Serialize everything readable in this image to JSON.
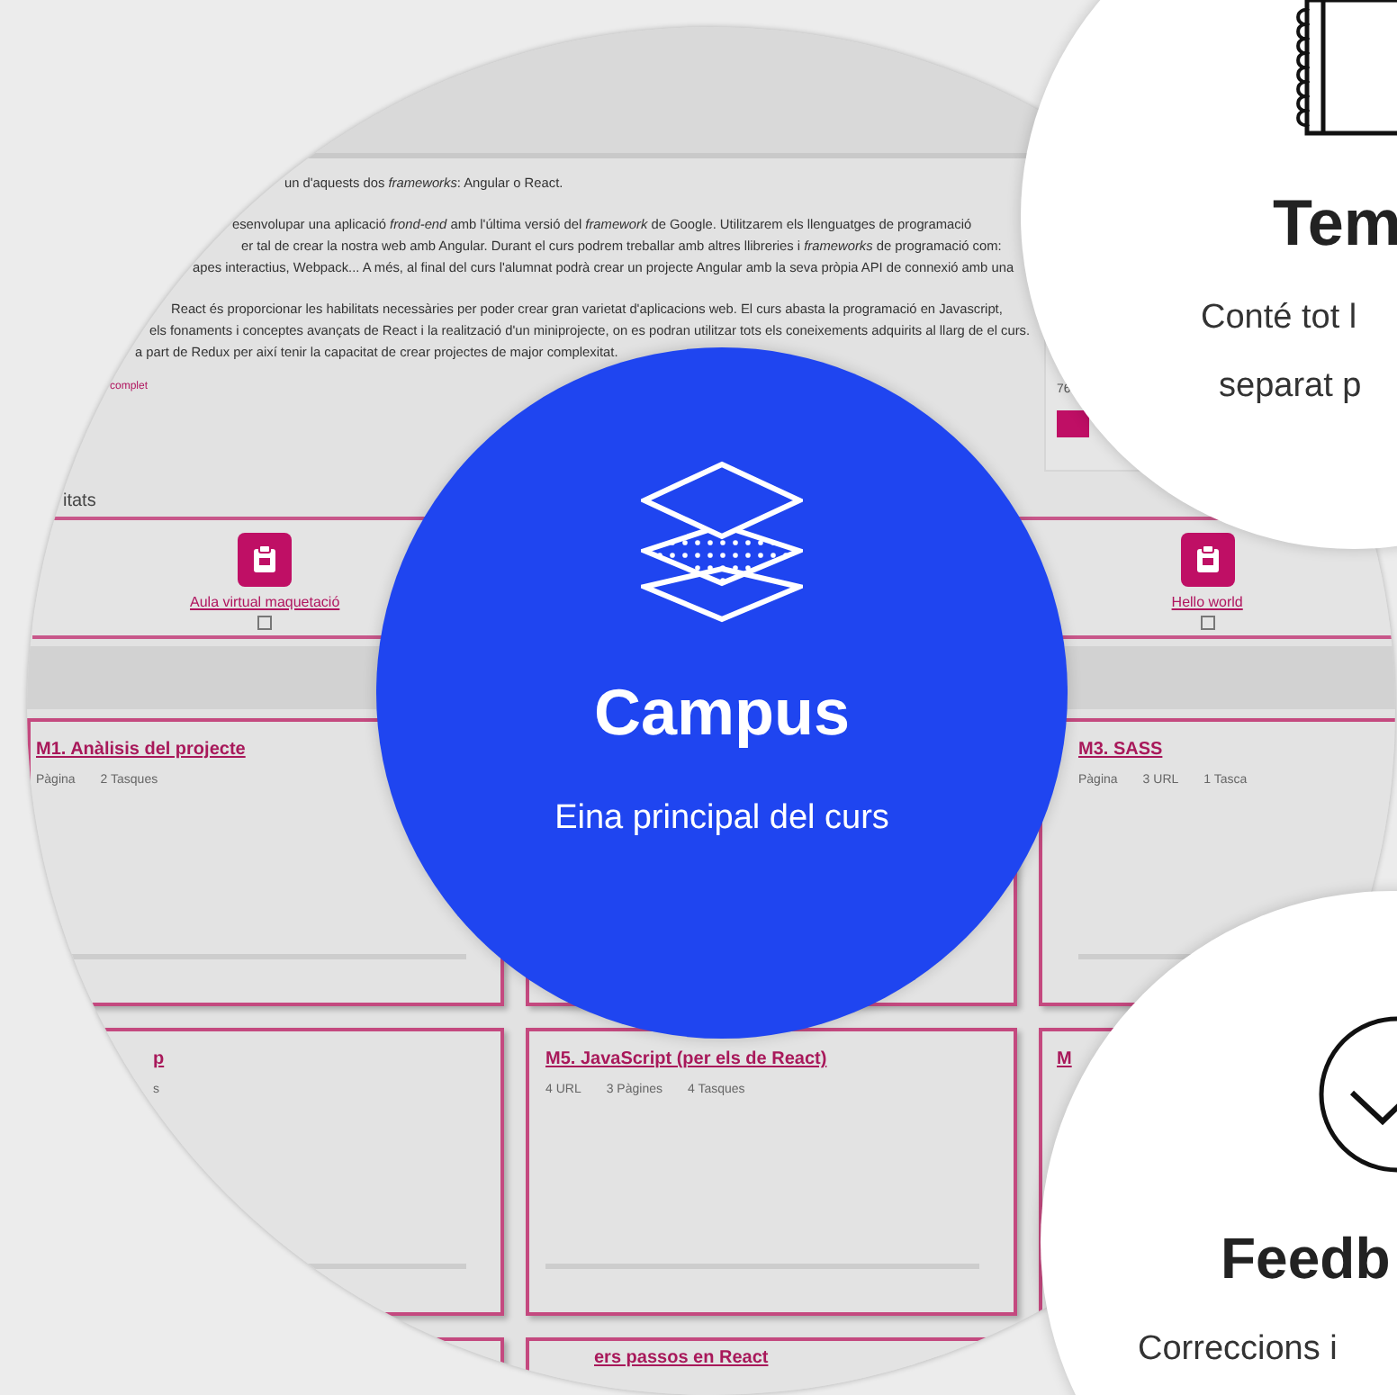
{
  "course_page": {
    "intro": "un d'aquests dos *frameworks*: Angular o React.",
    "paragraphs": [
      [
        "esenvolupar una aplicació *frond-end* amb l'última versió del *framework* de Google. Utilitzarem els llenguatges de programació",
        "er tal de crear la nostra web amb Angular. Durant el curs podrem treballar amb altres llibreries i *frameworks* de programació com:",
        "apes interactius, Webpack... A més, al final del curs l'alumnat podrà crear un projecte Angular amb la seva pròpia API de connexió amb una"
      ],
      [
        "React és proporcionar les habilitats necessàries per poder crear gran varietat d'aplicacions web. El curs abasta la programació en Javascript,",
        "els fonaments i conceptes avançats de React i la realització d'un miniprojecte, on es podran utilitzar tots els coneixements adquirits al llarg de el curs.",
        "a part de Redux per així tenir la capacitat de crear projectes de major complexitat."
      ]
    ],
    "more_link": "complet",
    "side_card": {
      "count": "76"
    },
    "section_heading": "itats",
    "activities": [
      {
        "label": "Aula virtual maquetació",
        "checked": false
      },
      {
        "label": "Hello world",
        "checked": false
      }
    ],
    "modules": [
      {
        "title": "M1. Anàlisis del projecte",
        "meta": [
          "Pàgina",
          "2 Tasques"
        ]
      },
      {
        "title": "M3. SASS",
        "meta": [
          "Pàgina",
          "3 URL",
          "1 Tasca"
        ]
      },
      {
        "title": "p",
        "meta": [
          "s"
        ]
      },
      {
        "title": "M5. JavaScript (per els de React)",
        "meta": [
          "4 URL",
          "3 Pàgines",
          "4 Tasques"
        ]
      },
      {
        "title": "M"
      },
      {
        "title": "ers passos en React"
      }
    ]
  },
  "features": [
    {
      "kind": "campus",
      "title": "Campus",
      "lines": [
        "Eina principal del curs"
      ]
    },
    {
      "kind": "notes",
      "title": "Tem",
      "lines": [
        "Conté tot l",
        "separat p"
      ]
    },
    {
      "kind": "feedback",
      "title": "Feedb",
      "lines": [
        "Correccions i"
      ]
    }
  ]
}
